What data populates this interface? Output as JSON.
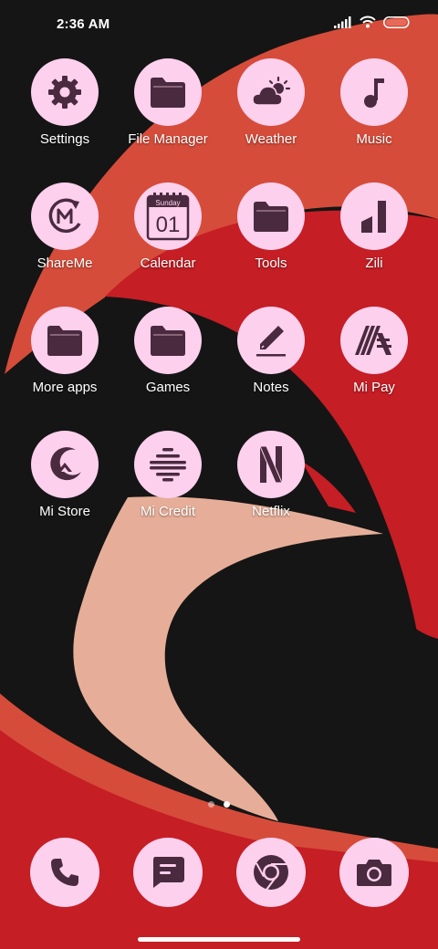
{
  "status_bar": {
    "time": "2:36 AM"
  },
  "home": {
    "rows": [
      [
        {
          "label": "Settings",
          "icon": "settings-gear-icon"
        },
        {
          "label": "File Manager",
          "icon": "folder-icon"
        },
        {
          "label": "Weather",
          "icon": "cloud-sun-icon"
        },
        {
          "label": "Music",
          "icon": "music-note-icon"
        }
      ],
      [
        {
          "label": "ShareMe",
          "icon": "shareme-icon"
        },
        {
          "label": "Calendar",
          "icon": "calendar-icon",
          "day_name": "Sunday",
          "day_num": "01"
        },
        {
          "label": "Tools",
          "icon": "folder-icon"
        },
        {
          "label": "Zili",
          "icon": "zili-icon"
        }
      ],
      [
        {
          "label": "More apps",
          "icon": "folder-icon"
        },
        {
          "label": "Games",
          "icon": "folder-icon"
        },
        {
          "label": "Notes",
          "icon": "pencil-icon"
        },
        {
          "label": "Mi Pay",
          "icon": "mi-pay-icon"
        }
      ],
      [
        {
          "label": "Mi Store",
          "icon": "mi-store-icon"
        },
        {
          "label": "Mi Credit",
          "icon": "mi-credit-icon"
        },
        {
          "label": "Netflix",
          "icon": "netflix-icon"
        }
      ]
    ],
    "page_indicator": {
      "pages": 2,
      "current": 2
    }
  },
  "dock": [
    {
      "name": "Phone",
      "icon": "phone-icon"
    },
    {
      "name": "Messaging",
      "icon": "message-icon"
    },
    {
      "name": "Chrome",
      "icon": "chrome-icon"
    },
    {
      "name": "Camera",
      "icon": "camera-icon"
    }
  ],
  "colors": {
    "icon_bg": "#fdd0ee",
    "icon_fg": "#4a2a3e",
    "wall_red": "#c51e25",
    "wall_orange": "#d64c3a",
    "wall_peach": "#e6ae98",
    "wall_black": "#151515"
  }
}
